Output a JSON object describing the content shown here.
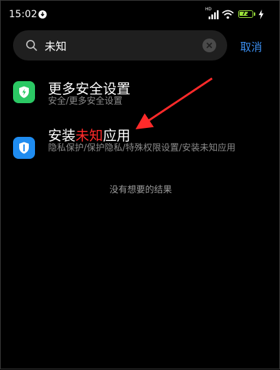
{
  "status_bar": {
    "time": "15:02",
    "network_label": "HD",
    "battery_level": "72",
    "battery_percent": 72
  },
  "search": {
    "query": "未知",
    "placeholder": "",
    "cancel_label": "取消"
  },
  "results": [
    {
      "title": "更多安全设置",
      "subtitle": "安全/更多安全设置",
      "icon": "shield-bolt-icon",
      "icon_color": "#2bc864"
    },
    {
      "title_prefix": "安装",
      "title_highlight": "未知",
      "title_suffix": "应用",
      "subtitle": "隐私保护/保护隐私/特殊权限设置/安装未知应用",
      "icon": "privacy-shield-icon",
      "icon_color": "#1f8cf0"
    }
  ],
  "footer_text": "没有想要的结果",
  "colors": {
    "background": "#000000",
    "accent": "#3b8ef0",
    "highlight": "#ff2a2a",
    "annotation_arrow": "#ff2a2a"
  }
}
